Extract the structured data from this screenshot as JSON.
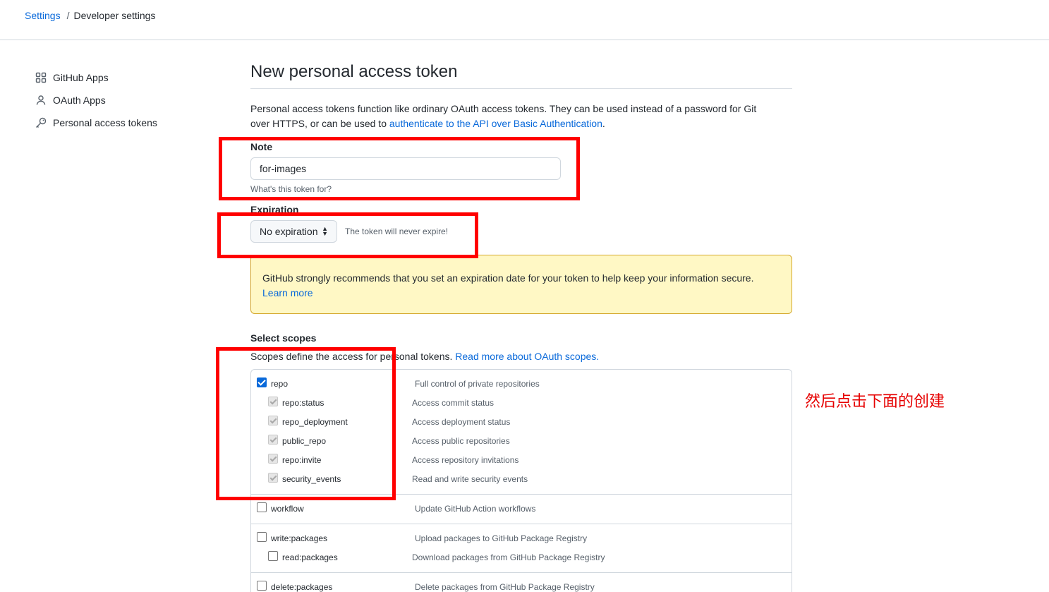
{
  "breadcrumb": {
    "settings": "Settings",
    "separator": "/",
    "current": "Developer settings"
  },
  "sidebar": {
    "items": [
      {
        "label": "GitHub Apps",
        "icon": "apps-grid-icon"
      },
      {
        "label": "OAuth Apps",
        "icon": "person-icon"
      },
      {
        "label": "Personal access tokens",
        "icon": "key-icon"
      }
    ]
  },
  "main": {
    "title": "New personal access token",
    "intro_text": "Personal access tokens function like ordinary OAuth access tokens. They can be used instead of a password for Git over HTTPS, or can be used to ",
    "intro_link": "authenticate to the API over Basic Authentication",
    "intro_end": ".",
    "note": {
      "label": "Note",
      "value": "for-images",
      "help": "What's this token for?"
    },
    "expiration": {
      "label": "Expiration",
      "selected": "No expiration",
      "note": "The token will never expire!"
    },
    "flash": {
      "text": "GitHub strongly recommends that you set an expiration date for your token to help keep your information secure.",
      "link": "Learn more"
    },
    "scopes": {
      "label": "Select scopes",
      "desc": "Scopes define the access for personal tokens. ",
      "desc_link": "Read more about OAuth scopes.",
      "groups": [
        {
          "parent": {
            "name": "repo",
            "desc": "Full control of private repositories",
            "checked": true
          },
          "children": [
            {
              "name": "repo:status",
              "desc": "Access commit status"
            },
            {
              "name": "repo_deployment",
              "desc": "Access deployment status"
            },
            {
              "name": "public_repo",
              "desc": "Access public repositories"
            },
            {
              "name": "repo:invite",
              "desc": "Access repository invitations"
            },
            {
              "name": "security_events",
              "desc": "Read and write security events"
            }
          ]
        },
        {
          "parent": {
            "name": "workflow",
            "desc": "Update GitHub Action workflows",
            "checked": false
          },
          "children": []
        },
        {
          "parent": {
            "name": "write:packages",
            "desc": "Upload packages to GitHub Package Registry",
            "checked": false
          },
          "children": [
            {
              "name": "read:packages",
              "desc": "Download packages from GitHub Package Registry"
            }
          ]
        },
        {
          "parent": {
            "name": "delete:packages",
            "desc": "Delete packages from GitHub Package Registry",
            "checked": false
          },
          "children": []
        }
      ]
    }
  },
  "annotation": {
    "text": "然后点击下面的创建",
    "color": "#ff0000"
  },
  "colors": {
    "link": "#0969da",
    "flash_bg": "#fff8c5",
    "annotation_box": "#ff0000"
  }
}
